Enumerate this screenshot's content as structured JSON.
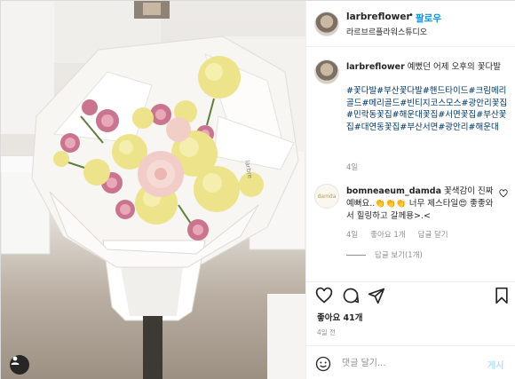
{
  "header": {
    "username": "larbreflower",
    "follow_label": "팔로우",
    "subtitle": "라르브르플라워스튜디오"
  },
  "caption": {
    "username": "larbreflower",
    "text": "예뻤던 어제 오후의 꽃다발",
    "hashtags": "#꽃다발#부산꽃다발#핸드타이드#크림메리골드#메리골드#빈티지코스모스#광안리꽃집#민락동꽃집#해운대꽃집#서면꽃집#부산꽃집#대연동꽃집#부산서면#광안리#해운대",
    "time": "4일"
  },
  "comment": {
    "username": "bomneaeum_damda",
    "text": "꽃색감이 진짜 예뻐요..👏👏👏 너무 제스타일😍 좋좋와서 힐링하고 갈께용>.<",
    "time": "4일",
    "likes": "좋아요 1개",
    "reply_label": "답글 달기",
    "view_replies": "답글 보기(1개)"
  },
  "post": {
    "likes": "좋아요 41개",
    "time": "4일 전"
  },
  "add_comment": {
    "placeholder": "댓글 달기...",
    "post_label": "게시"
  },
  "icons": {
    "like": "heart-icon",
    "comment": "comment-icon",
    "share": "share-icon",
    "save": "bookmark-icon",
    "emoji": "emoji-icon",
    "user_tag": "user-tag-icon"
  }
}
